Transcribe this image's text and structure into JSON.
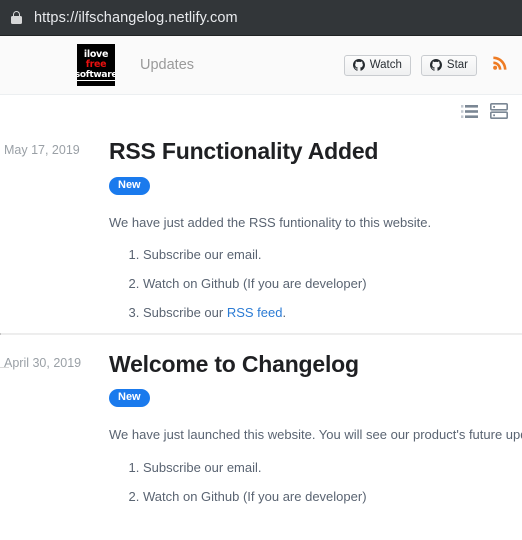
{
  "browser": {
    "url": "https://ilfschangelog.netlify.com",
    "lock_icon": "lock-icon"
  },
  "header": {
    "logo": {
      "line1": "ilove",
      "line2": "free",
      "line3": "software"
    },
    "nav_label": "Updates",
    "watch_button": "Watch",
    "star_button": "Star",
    "rss_icon": "rss-icon",
    "rss_color": "#ee7b23"
  },
  "toolbar": {
    "list_view_icon": "list-view-icon",
    "card_view_icon": "card-view-icon"
  },
  "colors": {
    "badge_blue": "#1a7aed",
    "link_blue": "#2b7bd4",
    "logo_red": "#e8100f"
  },
  "entries": [
    {
      "date": "May 17, 2019",
      "title": "RSS Functionality Added",
      "badge": "New",
      "text": "We have just added the RSS funtionality to this website.",
      "items": [
        {
          "prefix": "Subscribe our email.",
          "link": "",
          "suffix": ""
        },
        {
          "prefix": "Watch on Github (If you are developer)",
          "link": "",
          "suffix": ""
        },
        {
          "prefix": "Subscribe our ",
          "link": "RSS feed",
          "suffix": "."
        }
      ]
    },
    {
      "date": "April 30, 2019",
      "title": "Welcome to Changelog",
      "badge": "New",
      "text": "We have just launched this website. You will see our product's future updates",
      "items": [
        {
          "prefix": "Subscribe our email.",
          "link": "",
          "suffix": ""
        },
        {
          "prefix": "Watch on Github (If you are developer)",
          "link": "",
          "suffix": ""
        }
      ]
    }
  ]
}
